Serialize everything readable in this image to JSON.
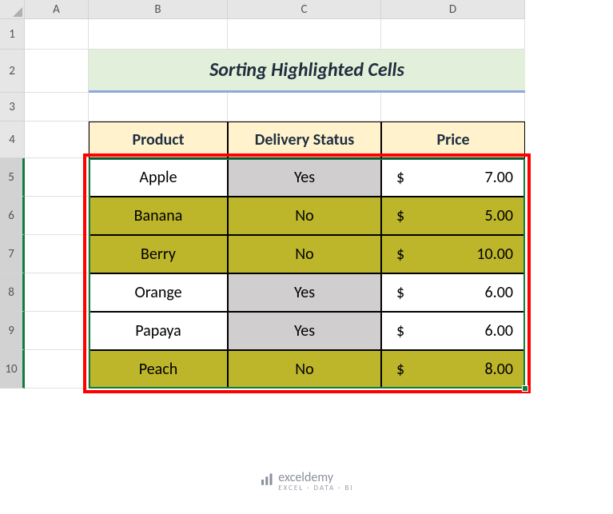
{
  "columns": {
    "a": "A",
    "b": "B",
    "c": "C",
    "d": "D"
  },
  "rows": {
    "r1": "1",
    "r2": "2",
    "r3": "3",
    "r4": "4",
    "r5": "5",
    "r6": "6",
    "r7": "7",
    "r8": "8",
    "r9": "9",
    "r10": "10"
  },
  "title": "Sorting Highlighted Cells",
  "headers": {
    "product": "Product",
    "status": "Delivery Status",
    "price": "Price"
  },
  "data": [
    {
      "product": "Apple",
      "status": "Yes",
      "currency": "$",
      "price": "7.00",
      "hl": "white",
      "statusHl": "gray"
    },
    {
      "product": "Banana",
      "status": "No",
      "currency": "$",
      "price": "5.00",
      "hl": "olive",
      "statusHl": "olive"
    },
    {
      "product": "Berry",
      "status": "No",
      "currency": "$",
      "price": "10.00",
      "hl": "olive",
      "statusHl": "olive"
    },
    {
      "product": "Orange",
      "status": "Yes",
      "currency": "$",
      "price": "6.00",
      "hl": "white",
      "statusHl": "gray"
    },
    {
      "product": "Papaya",
      "status": "Yes",
      "currency": "$",
      "price": "6.00",
      "hl": "white",
      "statusHl": "gray"
    },
    {
      "product": "Peach",
      "status": "No",
      "currency": "$",
      "price": "8.00",
      "hl": "olive",
      "statusHl": "olive"
    }
  ],
  "watermark": {
    "brand": "exceldemy",
    "tag": "EXCEL · DATA · BI"
  }
}
